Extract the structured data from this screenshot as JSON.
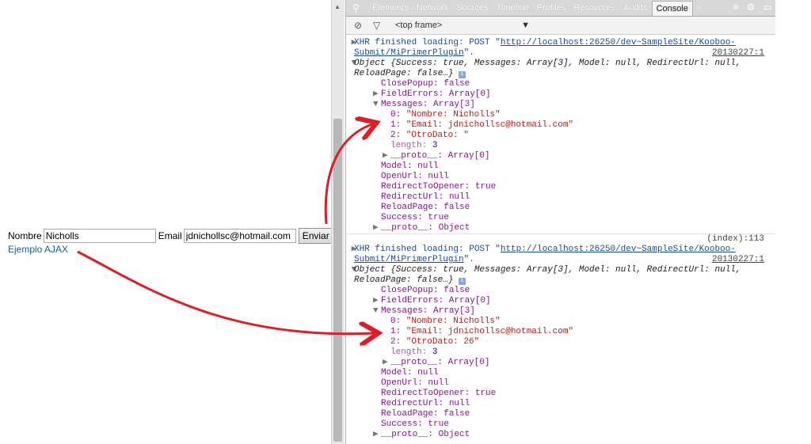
{
  "form": {
    "nombre_label": "Nombre",
    "nombre_value": "Nicholls",
    "email_label": "Email",
    "email_value": "jdnichollsc@hotmail.com",
    "submit_label": "Enviar",
    "ajax_link": "Ejemplo AJAX"
  },
  "devtools": {
    "tabs": [
      "Elements",
      "Network",
      "Sources",
      "Timeline",
      "Profiles",
      "Resources",
      "Audits",
      "Console"
    ],
    "more": "»",
    "frame_select": "<top frame>",
    "log1": {
      "xhr_prefix": "XHR finished loading: POST \"",
      "url1": "http://localhost:26250/dev~SampleSite/Kooboo-",
      "url2": "Submit/MiPrimerPlugin",
      "url_suffix": "\".",
      "source": "20130227:1",
      "object_line1": "Object {Success: true, Messages: Array[3], Model: null, RedirectUrl: null,",
      "object_line2": "ReloadPage: false…}",
      "close_popup": "ClosePopup: false",
      "field_errors": "FieldErrors: Array[0]",
      "messages": "Messages: Array[3]",
      "m0_key": "0: ",
      "m0_val": "\"Nombre: Nicholls\"",
      "m1_key": "1: ",
      "m1_val": "\"Email: jdnichollsc@hotmail.com\"",
      "m2_key": "2: ",
      "m2_val": "\"OtroDato: \"",
      "length_key": "length: ",
      "length_val": "3",
      "proto_arr": "__proto__: Array[0]",
      "model": "Model: null",
      "open_url": "OpenUrl: null",
      "redirect_opener": "RedirectToOpener: true",
      "redirect_url": "RedirectUrl: null",
      "reload_page": "ReloadPage: false",
      "success": "Success: true",
      "proto_obj": "__proto__: Object",
      "index_source": "(index):113"
    },
    "log2": {
      "xhr_prefix": "XHR finished loading: POST \"",
      "url1": "http://localhost:26250/dev~SampleSite/Kooboo-",
      "url2": "Submit/MiPrimerPlugin",
      "url_suffix": "\".",
      "source": "20130227:1",
      "object_line1": "Object {Success: true, Messages: Array[3], Model: null, RedirectUrl: null,",
      "object_line2": "ReloadPage: false…}",
      "close_popup": "ClosePopup: false",
      "field_errors": "FieldErrors: Array[0]",
      "messages": "Messages: Array[3]",
      "m0_key": "0: ",
      "m0_val": "\"Nombre: Nicholls\"",
      "m1_key": "1: ",
      "m1_val": "\"Email: jdnichollsc@hotmail.com\"",
      "m2_key": "2: ",
      "m2_val": "\"OtroDato: 26\"",
      "length_key": "length: ",
      "length_val": "3",
      "proto_arr": "__proto__: Array[0]",
      "model": "Model: null",
      "open_url": "OpenUrl: null",
      "redirect_opener": "RedirectToOpener: true",
      "redirect_url": "RedirectUrl: null",
      "reload_page": "ReloadPage: false",
      "success": "Success: true",
      "proto_obj": "__proto__: Object"
    }
  },
  "colors": {
    "arrow": "#e01c24",
    "console_key": "#881391",
    "console_string": "#c41a16"
  }
}
